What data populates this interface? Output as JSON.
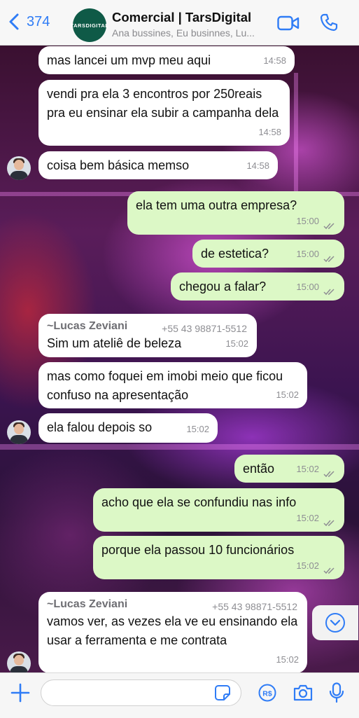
{
  "header": {
    "back_count": "374",
    "avatar_text": "TARSDIGITAL",
    "title": "Comercial | TarsDigital",
    "subtitle": "Ana bussines, Eu businnes, Lu..."
  },
  "messages": [
    {
      "dir": "in",
      "text": "mas lancei um mvp meu aqui",
      "time": "14:58"
    },
    {
      "dir": "in",
      "text": "vendi pra ela 3 encontros por 250reais pra eu ensinar ela subir a campanha dela",
      "time": "14:58"
    },
    {
      "dir": "in",
      "text": "coisa bem básica memso",
      "time": "14:58"
    },
    {
      "dir": "out",
      "text": "ela tem uma outra empresa?",
      "time": "15:00"
    },
    {
      "dir": "out",
      "text": "de estetica?",
      "time": "15:00"
    },
    {
      "dir": "out",
      "text": "chegou a falar?",
      "time": "15:00"
    },
    {
      "dir": "in",
      "sender": "~Lucas Zeviani",
      "phone": "+55 43 98871-5512",
      "text": "Sim um ateliê de beleza",
      "time": "15:02"
    },
    {
      "dir": "in",
      "text": "mas como foquei em imobi meio que ficou confuso na apresentação",
      "time": "15:02"
    },
    {
      "dir": "in",
      "text": "ela falou depois so",
      "time": "15:02"
    },
    {
      "dir": "out",
      "text": "então",
      "time": "15:02"
    },
    {
      "dir": "out",
      "text": "acho que ela se confundiu nas info",
      "time": "15:02"
    },
    {
      "dir": "out",
      "text": "porque ela passou 10 funcionários",
      "time": "15:02"
    },
    {
      "dir": "in",
      "sender": "~Lucas Zeviani",
      "phone": "+55 43 98871-5512",
      "text": "vamos ver, as vezes ela ve eu ensinando ela usar a ferramenta e me contrata",
      "time": "15:02"
    }
  ],
  "composer": {
    "placeholder": ""
  },
  "icons": {
    "back": "chevron-left-icon",
    "video": "video-call-icon",
    "phone": "phone-call-icon",
    "scroll": "chevron-down-circle-icon",
    "plus": "plus-icon",
    "sticker": "sticker-icon",
    "pay": "payment-icon",
    "camera": "camera-icon",
    "mic": "microphone-icon"
  },
  "colors": {
    "accent": "#2f7cf6",
    "incoming_bubble": "#ffffff",
    "outgoing_bubble": "#dcf8c6",
    "read_ticks": "#8e8e93"
  }
}
